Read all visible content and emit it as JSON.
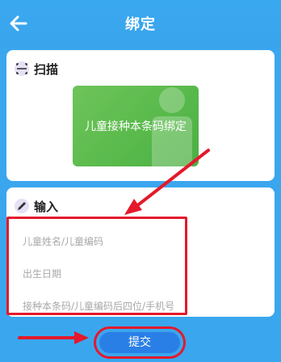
{
  "header": {
    "title": "绑定",
    "back_icon": "arrow-left-icon"
  },
  "scan": {
    "label": "扫描",
    "icon": "barcode-scan-icon",
    "banner_text": "儿童接种本条码绑定"
  },
  "input": {
    "label": "输入",
    "icon": "pencil-icon",
    "fields": [
      {
        "placeholder": "儿童姓名/儿童编码"
      },
      {
        "placeholder": "出生日期"
      },
      {
        "placeholder": "接种本条码/儿童编码后四位/手机号"
      }
    ]
  },
  "submit": {
    "label": "提交"
  },
  "colors": {
    "header_bg": "#3aa6ee",
    "banner_green": "#5bb84c",
    "annotation_red": "#e4192b",
    "submit_blue": "#2a7fe6"
  }
}
